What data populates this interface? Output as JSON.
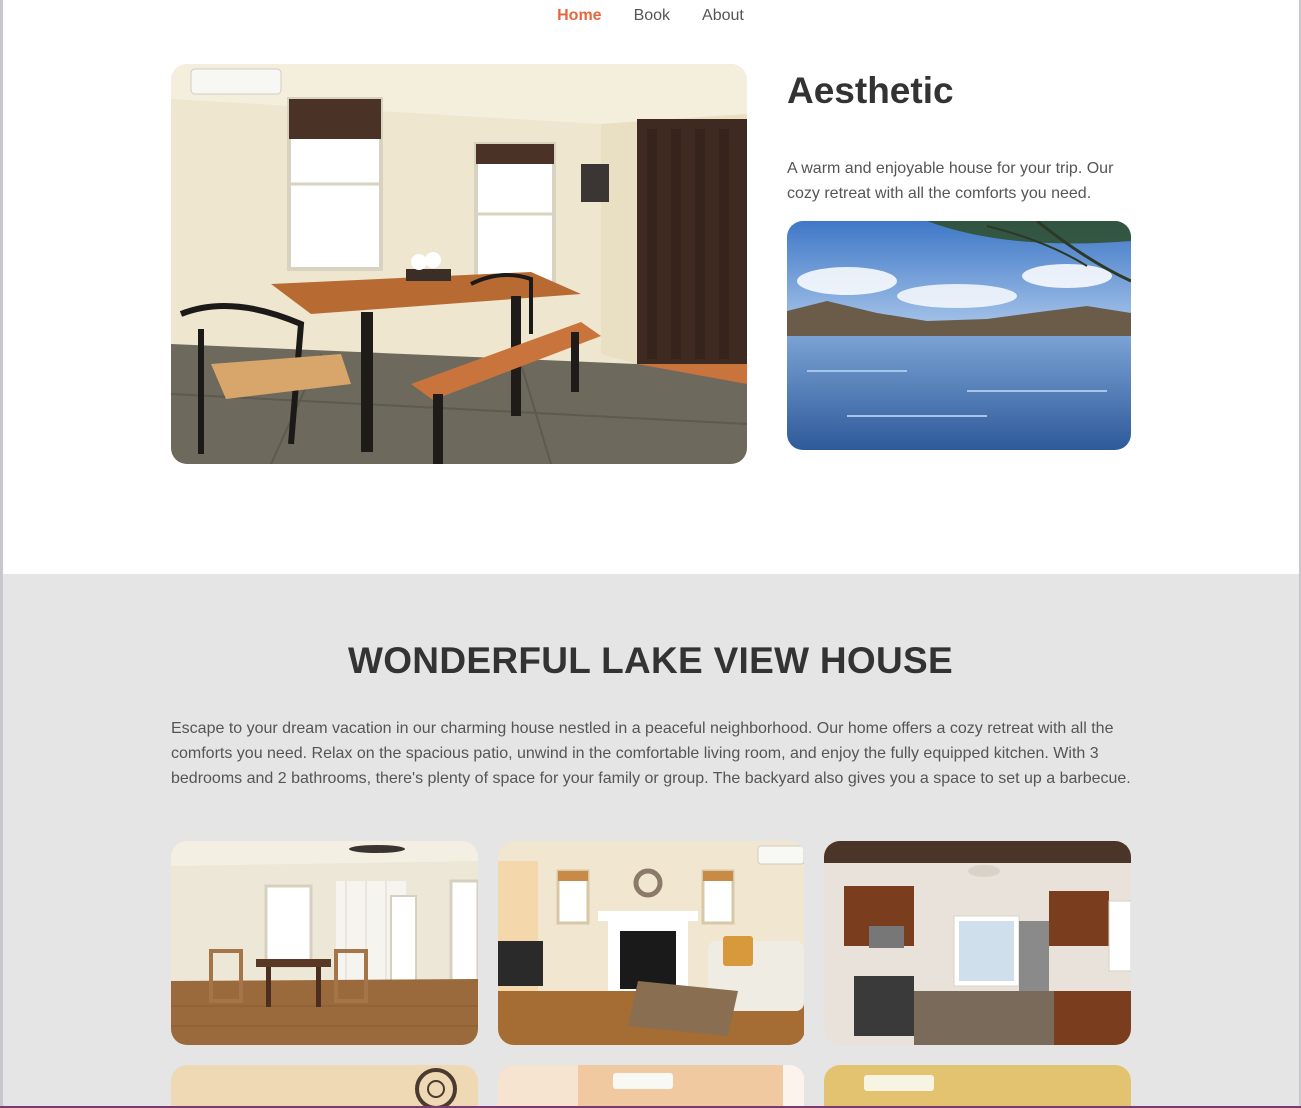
{
  "nav": {
    "items": [
      {
        "label": "Home",
        "active": true
      },
      {
        "label": "Book",
        "active": false
      },
      {
        "label": "About",
        "active": false
      }
    ],
    "accent_color": "#e8663d"
  },
  "hero": {
    "title": "Aesthetic",
    "text": "A warm and enjoyable house for your trip. Our cozy retreat with all the comforts you need."
  },
  "feature": {
    "title": "WONDERFUL LAKE VIEW HOUSE",
    "text": "Escape to your dream vacation in our charming house nestled in a peaceful neighborhood. Our home offers a cozy retreat with all the comforts you need. Relax on the spacious patio, unwind in the comfortable living room, and enjoy the fully equipped kitchen. With 3 bedrooms and 2 bathrooms, there's plenty of space for your family or group. The backyard also gives you a space to set up a barbecue."
  },
  "gallery": [
    "dining-room-photo",
    "living-room-photo",
    "kitchen-photo",
    "room-photo-4",
    "room-photo-5",
    "room-photo-6"
  ]
}
